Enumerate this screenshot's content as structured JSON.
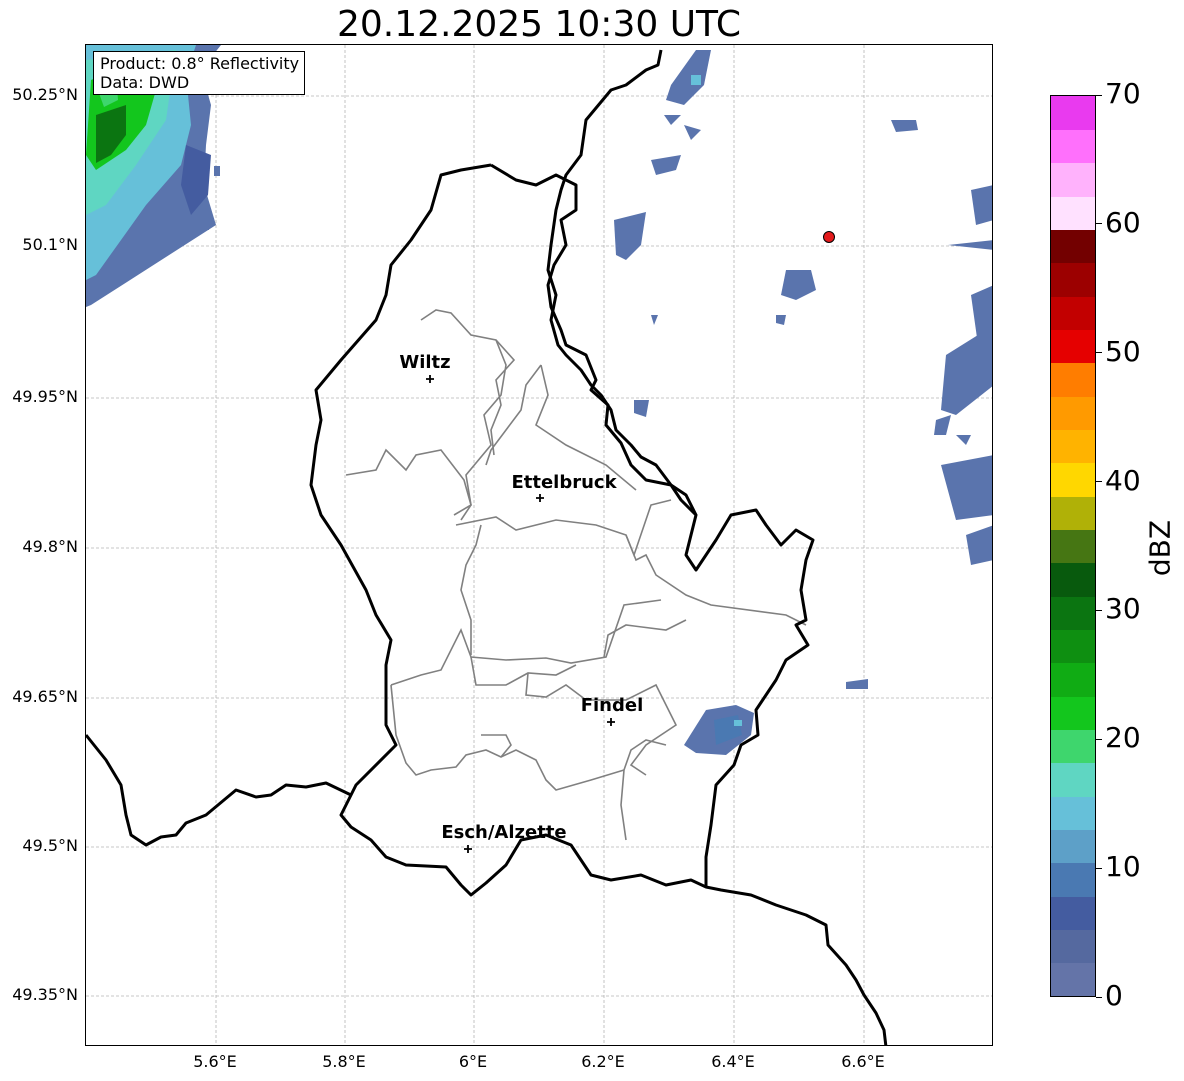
{
  "title": "20.12.2025 10:30 UTC",
  "product_box": {
    "line1": "Product: 0.8° Reflectivity",
    "line2": "Data: DWD"
  },
  "map": {
    "lon_range": [
      5.4,
      6.8
    ],
    "lat_range": [
      49.3,
      50.3
    ],
    "lat_ticks": [
      "49.35°N",
      "49.5°N",
      "49.65°N",
      "49.8°N",
      "49.95°N",
      "50.1°N",
      "50.25°N"
    ],
    "lon_ticks": [
      "5.6°E",
      "5.8°E",
      "6°E",
      "6.2°E",
      "6.4°E",
      "6.6°E"
    ],
    "cities": [
      {
        "name": "Wiltz"
      },
      {
        "name": "Ettelbruck"
      },
      {
        "name": "Findel"
      },
      {
        "name": "Esch/Alzette"
      }
    ],
    "radar_site_color": "#e31a1c",
    "border_color": "#000000",
    "canton_color": "#808080"
  },
  "colorbar": {
    "label": "dBZ",
    "min": 0,
    "max": 70,
    "step": 5,
    "ticks": [
      "0",
      "10",
      "20",
      "30",
      "40",
      "50",
      "60",
      "70"
    ],
    "colors": [
      "#6474a8",
      "#55699f",
      "#445ca0",
      "#4a79b2",
      "#5da0c8",
      "#66c0d9",
      "#5fd6c2",
      "#3ed66d",
      "#13c61d",
      "#10ac14",
      "#0e8f11",
      "#0b7511",
      "#085a0d",
      "#467613",
      "#b0b107",
      "#ffd700",
      "#ffb300",
      "#ff9a00",
      "#ff7d00",
      "#e50000",
      "#c20000",
      "#9c0000",
      "#730000",
      "#ffe1ff",
      "#ffb2fc",
      "#ff70fc",
      "#e93aef"
    ]
  }
}
